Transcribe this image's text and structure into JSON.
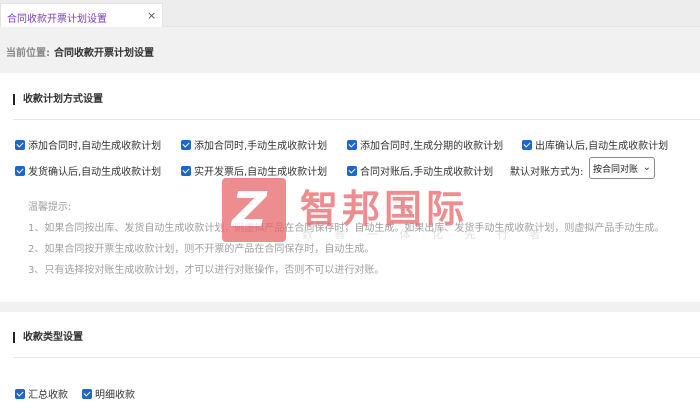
{
  "tab": {
    "label": "合同收款开票计划设置",
    "close": "×"
  },
  "location": {
    "prefix": "当前位置:",
    "value": "合同收款开票计划设置"
  },
  "section1": {
    "title": "收款计划方式设置",
    "row1": [
      "添加合同时,自动生成收款计划",
      "添加合同时,手动生成收款计划",
      "添加合同时,生成分期的收款计划",
      "出库确认后,自动生成收款计划"
    ],
    "row2": [
      "发货确认后,自动生成收款计划",
      "实开发票后,自动生成收款计划",
      "合同对账后,手动生成收款计划"
    ],
    "reconcile_label": "默认对账方式为:",
    "reconcile_value": "按合同对账",
    "tips": {
      "heading": "温馨提示:",
      "items": [
        "1、如果合同按出库、发货自动生成收款计划，则虚拟产品在合同保存时，自动生成。如果出库、发货手动生成收款计划，则虚拟产品手动生成。",
        "2、如果合同按开票生成收款计划，则不开票的产品在合同保存时，自动生成。",
        "3、只有选择按对账生成收款计划，才可以进行对账操作，否则不可以进行对账。"
      ]
    }
  },
  "section2": {
    "title": "收款类型设置",
    "options": [
      "汇总收款",
      "明细收款"
    ]
  },
  "watermark": {
    "logo": "Z",
    "title": "智邦国际",
    "subtitle": "数 智 一 体 化 先 行 者"
  },
  "colors": {
    "tab_text": "#7b3fb8",
    "checkbox": "#1e67c9",
    "watermark": "#e8676b"
  }
}
